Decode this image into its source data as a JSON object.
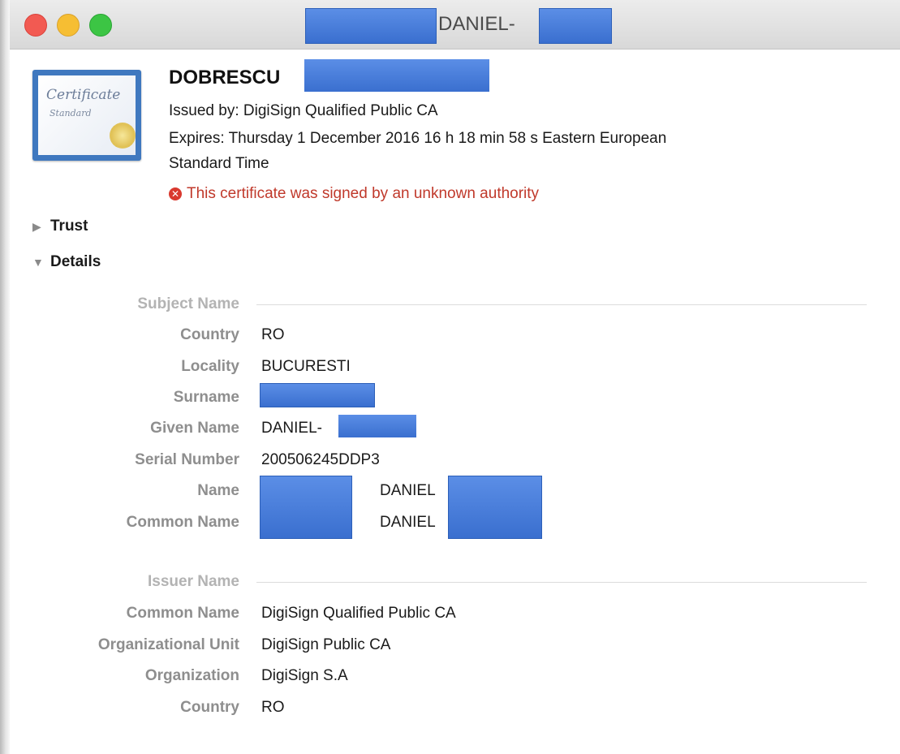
{
  "window": {
    "title": "DANIEL-"
  },
  "header": {
    "name": "DOBRESCU",
    "issued_by": "Issued by: DigiSign Qualified Public CA",
    "expires_line1": "Expires: Thursday 1 December 2016 16 h 18 min 58 s Eastern European",
    "expires_line2": "Standard Time",
    "error": "This certificate was signed by an unknown authority",
    "error_icon": "error-circle-icon",
    "cert_text_1": "Certificate",
    "cert_text_2": "Standard"
  },
  "sections": {
    "trust": "Trust",
    "details": "Details"
  },
  "subject": {
    "section": "Subject Name",
    "country_label": "Country",
    "country": "RO",
    "locality_label": "Locality",
    "locality": "BUCURESTI",
    "surname_label": "Surname",
    "given_name_label": "Given Name",
    "given_name": "DANIEL-",
    "serial_label": "Serial Number",
    "serial": "200506245DDP3",
    "name_label": "Name",
    "name": "DANIEL",
    "common_name_label": "Common Name",
    "common_name": "DANIEL"
  },
  "issuer": {
    "section": "Issuer Name",
    "common_name_label": "Common Name",
    "common_name": "DigiSign Qualified Public CA",
    "org_unit_label": "Organizational Unit",
    "org_unit": "DigiSign Public CA",
    "org_label": "Organization",
    "org": "DigiSign S.A",
    "country_label": "Country",
    "country": "RO"
  },
  "colors": {
    "error": "#c0392b",
    "redaction": "#3a6fcf"
  }
}
